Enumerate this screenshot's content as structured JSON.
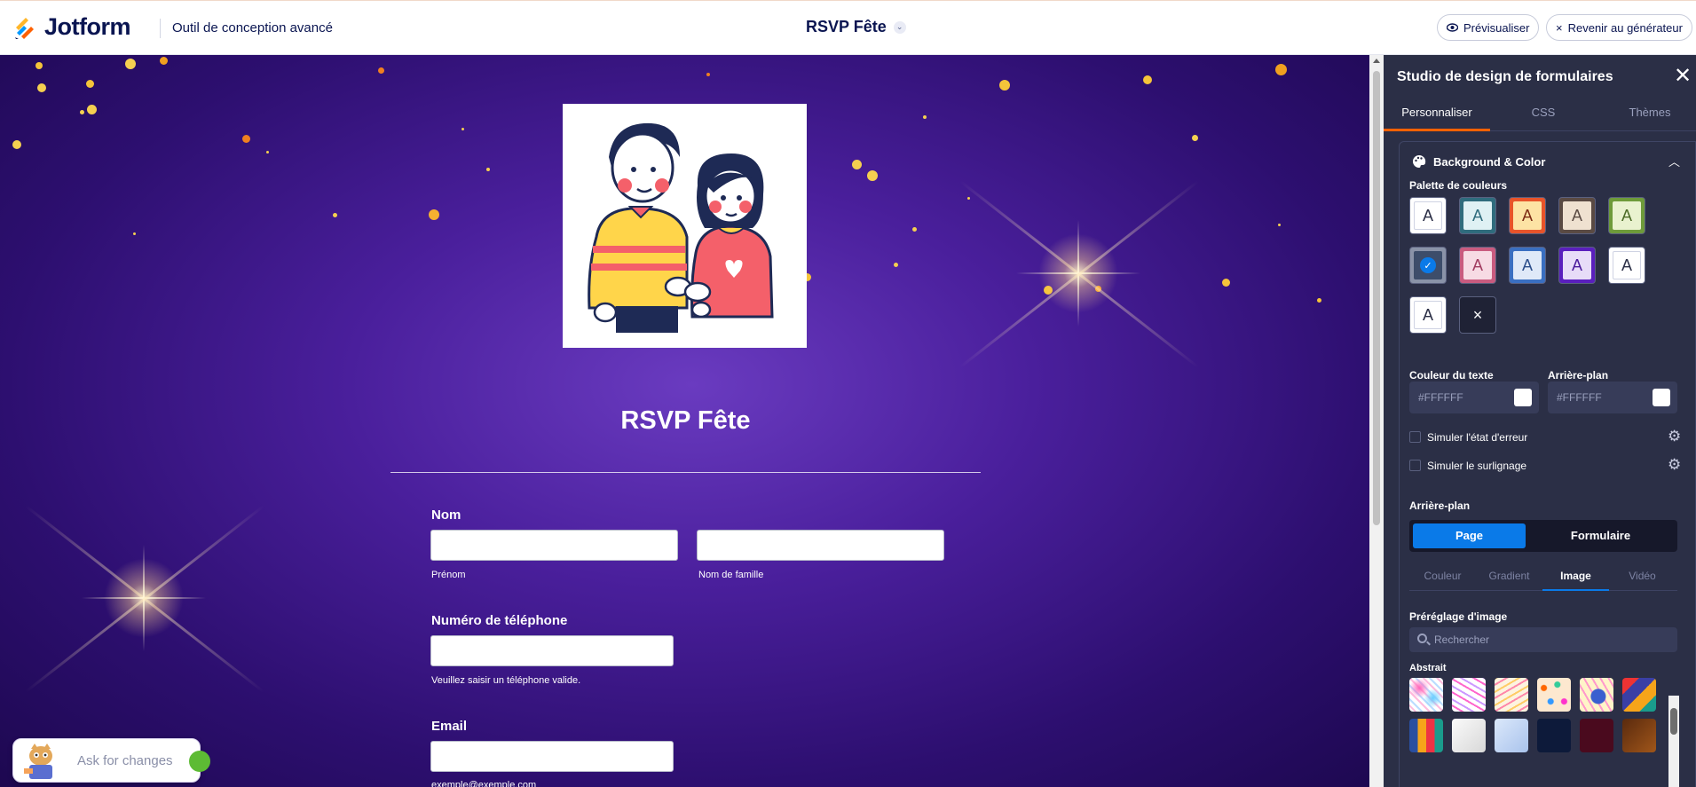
{
  "app": {
    "brand": "Jotform",
    "subtitle": "Outil de conception avancé"
  },
  "header": {
    "form_title": "RSVP Fête",
    "preview_label": "Prévisualiser",
    "back_label": "Revenir au générateur"
  },
  "form": {
    "title": "RSVP Fête",
    "fields": {
      "name_label": "Nom",
      "first_sub": "Prénom",
      "last_sub": "Nom de famille",
      "phone_label": "Numéro de téléphone",
      "phone_sub": "Veuillez saisir un téléphone valide.",
      "email_label": "Email",
      "email_sub": "exemple@exemple.com"
    }
  },
  "assistant": {
    "placeholder": "Ask for changes"
  },
  "panel": {
    "title": "Studio de design de formulaires",
    "tabs": [
      "Personnaliser",
      "CSS",
      "Thèmes"
    ],
    "section_title": "Background & Color",
    "palette_label": "Palette de couleurs",
    "swatches": [
      {
        "outer": "#ffffff",
        "inner": "#ffffff",
        "text": "#2b2f46",
        "label": "A"
      },
      {
        "outer": "#2f6c7d",
        "inner": "#dff1f4",
        "text": "#2f6c7d",
        "label": "A"
      },
      {
        "outer": "#e8542a",
        "inner": "#fde3a4",
        "text": "#7c2b14",
        "label": "A"
      },
      {
        "outer": "#5a4a43",
        "inner": "#efe1d0",
        "text": "#5a4a43",
        "label": "A"
      },
      {
        "outer": "#6e9b3a",
        "inner": "#e9f2cf",
        "text": "#4c6b27",
        "label": "A"
      },
      {
        "outer": "#8a93a8",
        "inner": "#3d4d6a",
        "text": "#ffffff",
        "label": "✓"
      },
      {
        "outer": "#c95b7f",
        "inner": "#f7dbe4",
        "text": "#a13c61",
        "label": "A"
      },
      {
        "outer": "#3a6fc1",
        "inner": "#dfe9f8",
        "text": "#2c4e8b",
        "label": "A"
      },
      {
        "outer": "#5a1fbd",
        "inner": "#e7dcf8",
        "text": "#4a1a9c",
        "label": "A"
      },
      {
        "outer": "#ffffff",
        "inner": "#ffffff",
        "text": "#2b2f46",
        "label": "A"
      },
      {
        "outer": "#ffffff",
        "inner": "#ffffff",
        "text": "#2b2f46",
        "label": "A"
      },
      {
        "outer": "#1f2235",
        "inner": "#1f2235",
        "text": "#ffffff",
        "label": "×"
      }
    ],
    "text_color_label": "Couleur du texte",
    "text_color_value": "#FFFFFF",
    "bg_label": "Arrière-plan",
    "bg_value": "#FFFFFF",
    "sim_error": "Simuler l'état d'erreur",
    "sim_highlight": "Simuler le surlignage",
    "background_heading": "Arrière-plan",
    "seg": [
      "Page",
      "Formulaire"
    ],
    "subtabs": [
      "Couleur",
      "Gradient",
      "Image",
      "Vidéo"
    ],
    "preset_label": "Préréglage d'image",
    "search_placeholder": "Rechercher",
    "category": "Abstrait"
  },
  "colors": {
    "accent": "#ff6100",
    "panel_bg": "#2b2f46",
    "active_blue": "#0a7ae8",
    "canvas_purple": "#4a1f9c"
  }
}
